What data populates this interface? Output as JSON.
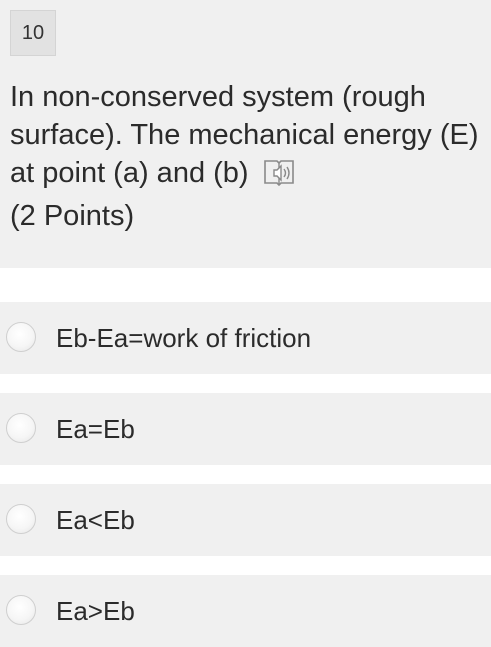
{
  "question": {
    "number": "10",
    "line1": "In non-conserved system (rough",
    "line2": "surface). The mechanical energy (E)",
    "line3": "at point (a) and (b)",
    "points": "(2 Points)",
    "reader_icon": "immersive-reader-icon"
  },
  "options": [
    {
      "label": "Eb-Ea=work of friction"
    },
    {
      "label": "Ea=Eb"
    },
    {
      "label": "Ea<Eb"
    },
    {
      "label": "Ea>Eb"
    }
  ],
  "colors": {
    "panel_background": "#f0f0f0",
    "page_background": "#ffffff",
    "text": "#2b2b2b",
    "radio_border": "#cfcfcf"
  }
}
